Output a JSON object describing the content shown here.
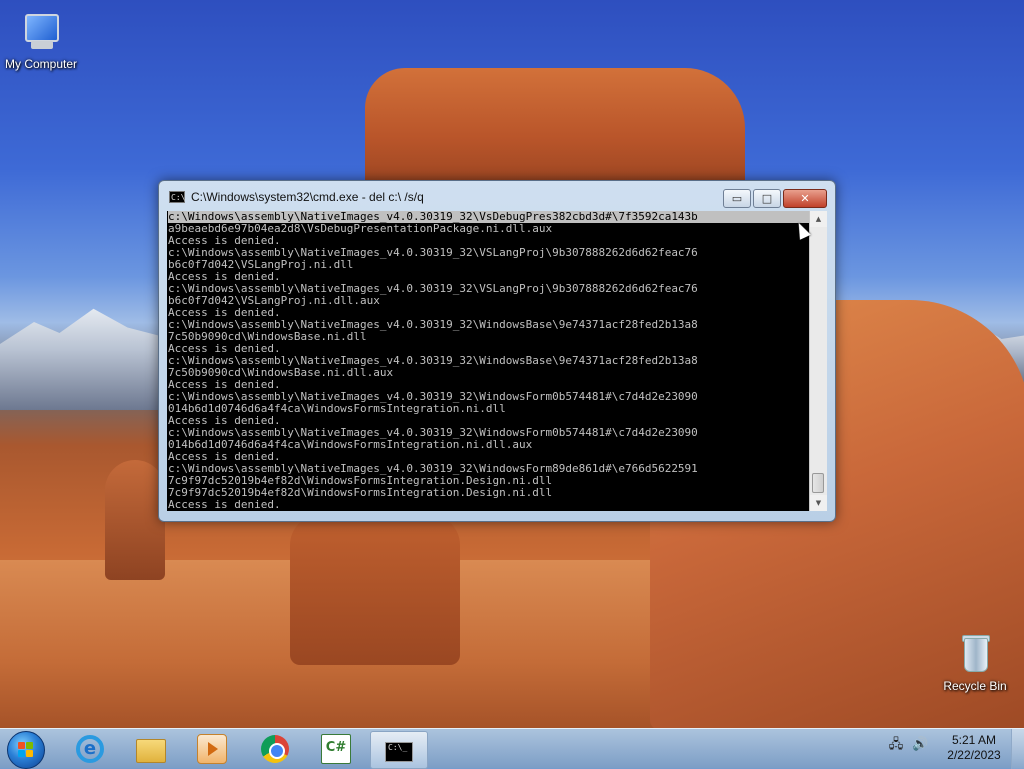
{
  "desktop": {
    "icons": [
      {
        "label": "My Computer",
        "icon": "computer-icon"
      },
      {
        "label": "Recycle Bin",
        "icon": "recycle-bin-icon"
      }
    ]
  },
  "window": {
    "title": "C:\\Windows\\system32\\cmd.exe - del  c:\\ /s/q",
    "icon": "cmd-icon",
    "buttons": {
      "minimize": "▭",
      "maximize": "□",
      "close": "✕"
    }
  },
  "console": {
    "lines": [
      "c:\\Windows\\assembly\\NativeImages_v4.0.30319_32\\VsDebugPres382cbd3d#\\7f3592ca143b",
      "a9beaebd6e97b04ea2d8\\VsDebugPresentationPackage.ni.dll.aux",
      "Access is denied.",
      "c:\\Windows\\assembly\\NativeImages_v4.0.30319_32\\VSLangProj\\9b307888262d6d62feac76",
      "b6c0f7d042\\VSLangProj.ni.dll",
      "Access is denied.",
      "c:\\Windows\\assembly\\NativeImages_v4.0.30319_32\\VSLangProj\\9b307888262d6d62feac76",
      "b6c0f7d042\\VSLangProj.ni.dll.aux",
      "Access is denied.",
      "c:\\Windows\\assembly\\NativeImages_v4.0.30319_32\\WindowsBase\\9e74371acf28fed2b13a8",
      "7c50b9090cd\\WindowsBase.ni.dll",
      "Access is denied.",
      "c:\\Windows\\assembly\\NativeImages_v4.0.30319_32\\WindowsBase\\9e74371acf28fed2b13a8",
      "7c50b9090cd\\WindowsBase.ni.dll.aux",
      "Access is denied.",
      "c:\\Windows\\assembly\\NativeImages_v4.0.30319_32\\WindowsForm0b574481#\\c7d4d2e23090",
      "014b6d1d0746d6a4f4ca\\WindowsFormsIntegration.ni.dll",
      "Access is denied.",
      "c:\\Windows\\assembly\\NativeImages_v4.0.30319_32\\WindowsForm0b574481#\\c7d4d2e23090",
      "014b6d1d0746d6a4f4ca\\WindowsFormsIntegration.ni.dll.aux",
      "Access is denied.",
      "c:\\Windows\\assembly\\NativeImages_v4.0.30319_32\\WindowsForm89de861d#\\e766d5622591",
      "7c9f97dc52019b4ef82d\\WindowsFormsIntegration.Design.ni.dll",
      "7c9f97dc52019b4ef82d\\WindowsFormsIntegration.Design.ni.dll",
      "Access is denied."
    ]
  },
  "taskbar": {
    "start_icon": "windows-start-icon",
    "items": [
      {
        "name": "internet-explorer",
        "icon": "internet-explorer-icon",
        "glyph": "e"
      },
      {
        "name": "file-explorer",
        "icon": "folder-icon",
        "glyph": ""
      },
      {
        "name": "media-player",
        "icon": "media-player-icon",
        "glyph": ""
      },
      {
        "name": "chrome",
        "icon": "chrome-icon",
        "glyph": ""
      },
      {
        "name": "csharp-editor",
        "icon": "csharp-icon",
        "glyph": "C#"
      },
      {
        "name": "cmd",
        "icon": "cmd-icon",
        "glyph": "C:\\_"
      }
    ],
    "tray": {
      "network_icon": "network-icon",
      "volume_icon": "volume-icon",
      "network_glyph": "🖧",
      "volume_glyph": "🔊"
    },
    "clock": {
      "time": "5:21 AM",
      "date": "2/22/2023"
    }
  }
}
